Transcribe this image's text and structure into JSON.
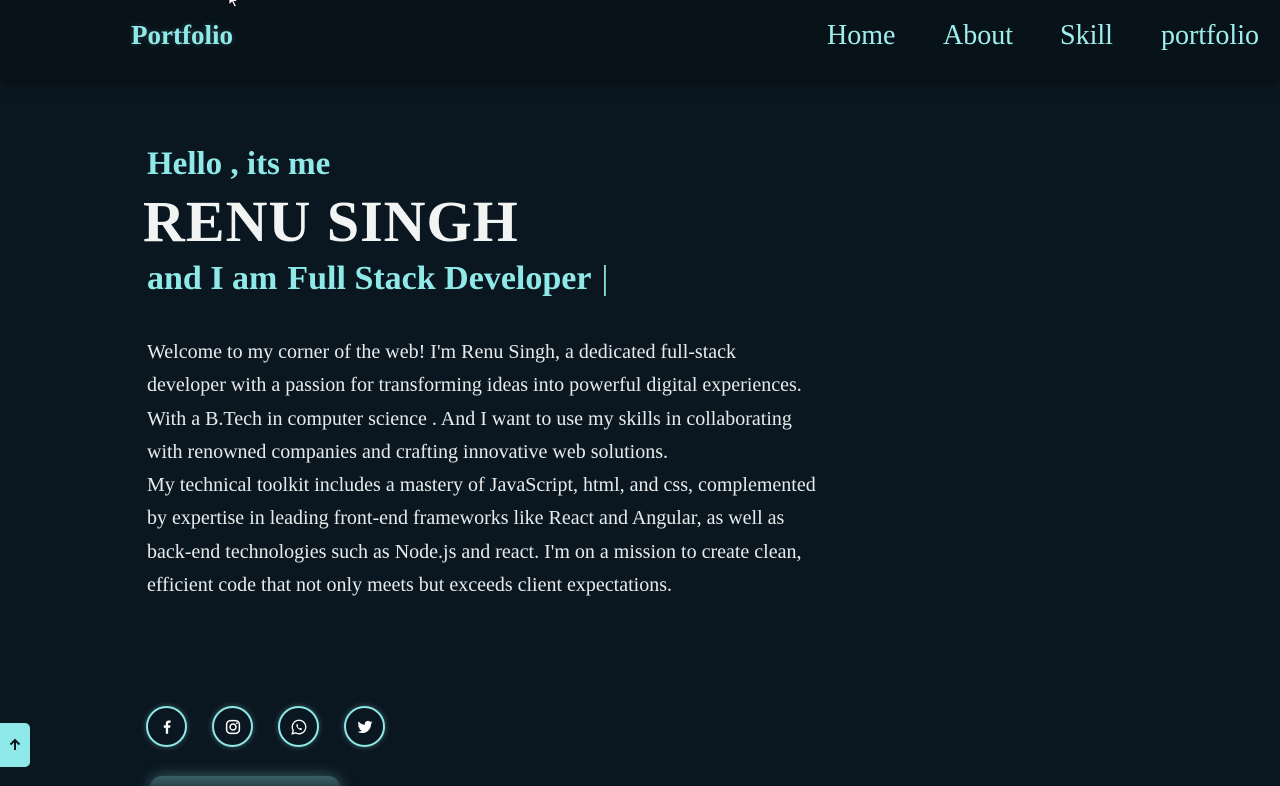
{
  "header": {
    "logo": "Portfolio",
    "nav": [
      "Home",
      "About",
      "Skill",
      "portfolio"
    ]
  },
  "hero": {
    "greeting": "Hello , its me",
    "name": "RENU SINGH",
    "role_prefix": "and I am",
    "role": "Full Stack Developer",
    "caret": "|",
    "paragraph1": "Welcome to my corner of the web! I'm Renu Singh, a dedicated full-stack developer with a passion for transforming ideas into powerful digital experiences. With a B.Tech in computer science . And I want to use my skills in collaborating with renowned companies and crafting innovative web solutions.",
    "paragraph2": "My technical toolkit includes a mastery of JavaScript, html, and css, complemented by expertise in leading front-end frameworks like React and Angular, as well as back-end technologies such as Node.js and react. I'm on a mission to create clean, efficient code that not only meets but exceeds client expectations."
  },
  "social": [
    "facebook-icon",
    "instagram-icon",
    "whatsapp-icon",
    "twitter-icon"
  ],
  "scroll_top": {
    "icon": "arrow-up-icon"
  },
  "colors": {
    "background": "#0b1720",
    "header": "#081219",
    "accent": "#8fe9e8",
    "text": "#e6eaec"
  }
}
